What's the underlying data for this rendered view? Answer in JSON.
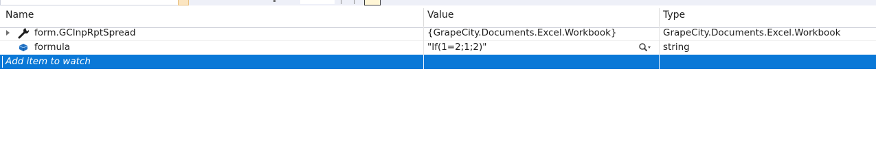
{
  "columns": {
    "name": "Name",
    "value": "Value",
    "type": "Type"
  },
  "rows": [
    {
      "name": "form.GCInpRptSpread",
      "value": "{GrapeCity.Documents.Excel.Workbook}",
      "type": "GrapeCity.Documents.Excel.Workbook",
      "icon": "wrench-icon",
      "expandable": true
    },
    {
      "name": "formula",
      "value": "\"If(1=2;1;2)\"",
      "type": "string",
      "icon": "field-icon",
      "expandable": false,
      "value_tools": [
        "text-visualizer-search-icon",
        "dropdown-arrow-icon"
      ]
    }
  ],
  "add_item": {
    "placeholder": "Add item to watch"
  },
  "colors": {
    "selection": "#0A78D7",
    "header_border": "#CCCED8",
    "field_icon": "#1E6FC2"
  }
}
